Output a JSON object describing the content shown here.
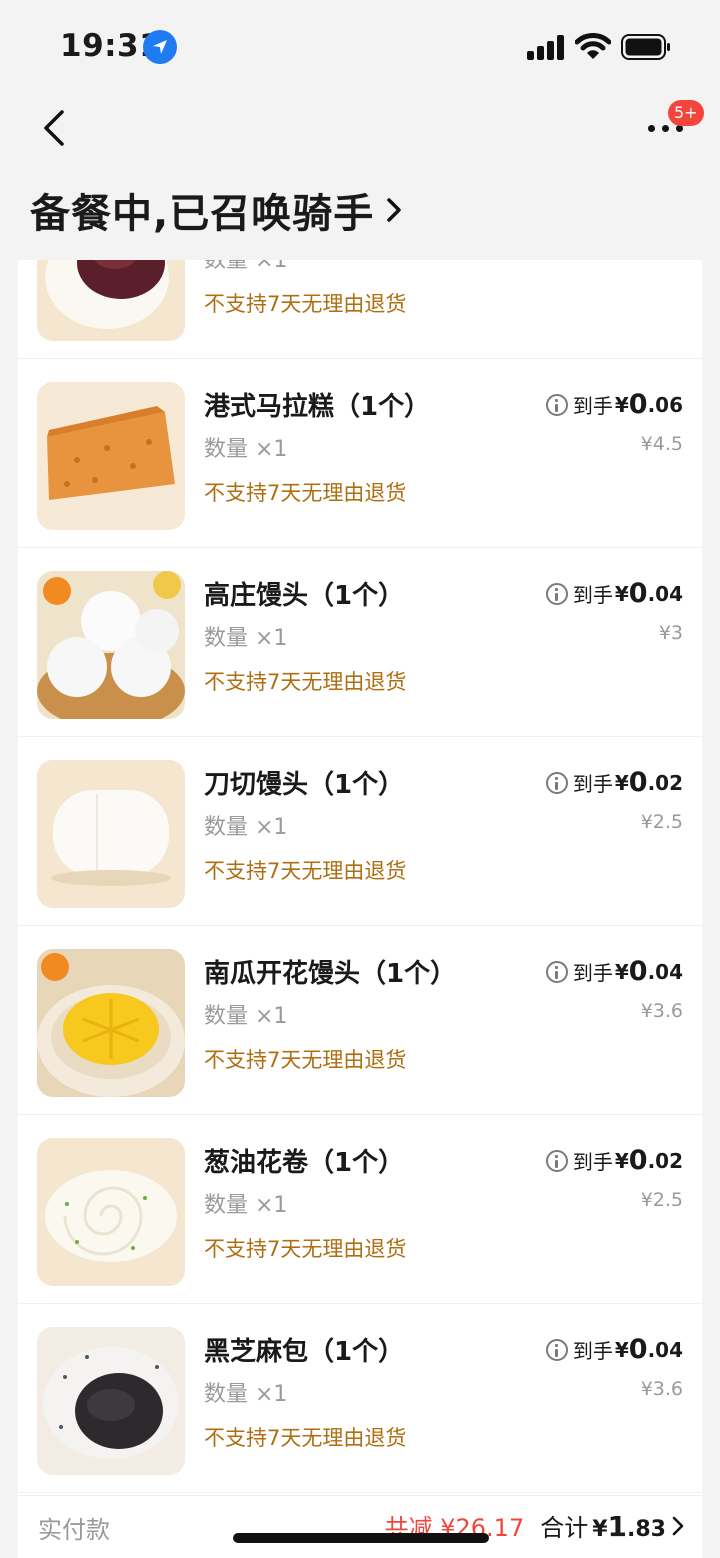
{
  "status_bar": {
    "time": "19:31"
  },
  "header": {
    "badge": "5+",
    "order_status": "备餐中,已召唤骑手"
  },
  "colors": {
    "accent_red": "#f2463c",
    "policy_brown": "#b06e12",
    "location_blue": "#1e7bf2"
  },
  "items": [
    {
      "name": "",
      "qty": "数量 ×1",
      "policy": "不支持7天无理由退货",
      "image": "red-bean-bun"
    },
    {
      "name": "港式马拉糕（1个）",
      "qty": "数量 ×1",
      "policy": "不支持7天无理由退货",
      "price_label": "到手",
      "currency": "¥",
      "price_int": "0",
      "price_dec": ".06",
      "orig_price": "¥4.5",
      "image": "malay-sponge-cake"
    },
    {
      "name": "高庄馒头（1个）",
      "qty": "数量 ×1",
      "policy": "不支持7天无理由退货",
      "price_label": "到手",
      "currency": "¥",
      "price_int": "0",
      "price_dec": ".04",
      "orig_price": "¥3",
      "image": "gaozhuang-buns"
    },
    {
      "name": "刀切馒头（1个）",
      "qty": "数量 ×1",
      "policy": "不支持7天无理由退货",
      "price_label": "到手",
      "currency": "¥",
      "price_int": "0",
      "price_dec": ".02",
      "orig_price": "¥2.5",
      "image": "knife-cut-bun"
    },
    {
      "name": "南瓜开花馒头（1个）",
      "qty": "数量 ×1",
      "policy": "不支持7天无理由退货",
      "price_label": "到手",
      "currency": "¥",
      "price_int": "0",
      "price_dec": ".04",
      "orig_price": "¥3.6",
      "image": "pumpkin-bun"
    },
    {
      "name": "葱油花卷（1个）",
      "qty": "数量 ×1",
      "policy": "不支持7天无理由退货",
      "price_label": "到手",
      "currency": "¥",
      "price_int": "0",
      "price_dec": ".02",
      "orig_price": "¥2.5",
      "image": "scallion-roll"
    },
    {
      "name": "黑芝麻包（1个）",
      "qty": "数量 ×1",
      "policy": "不支持7天无理由退货",
      "price_label": "到手",
      "currency": "¥",
      "price_int": "0",
      "price_dec": ".04",
      "orig_price": "¥3.6",
      "image": "black-sesame-bun"
    }
  ],
  "footer": {
    "label": "实付款",
    "discount": "共减 ¥26.17",
    "total_label": "合计",
    "total_currency": "¥",
    "total_int": "1",
    "total_dec": ".83"
  }
}
